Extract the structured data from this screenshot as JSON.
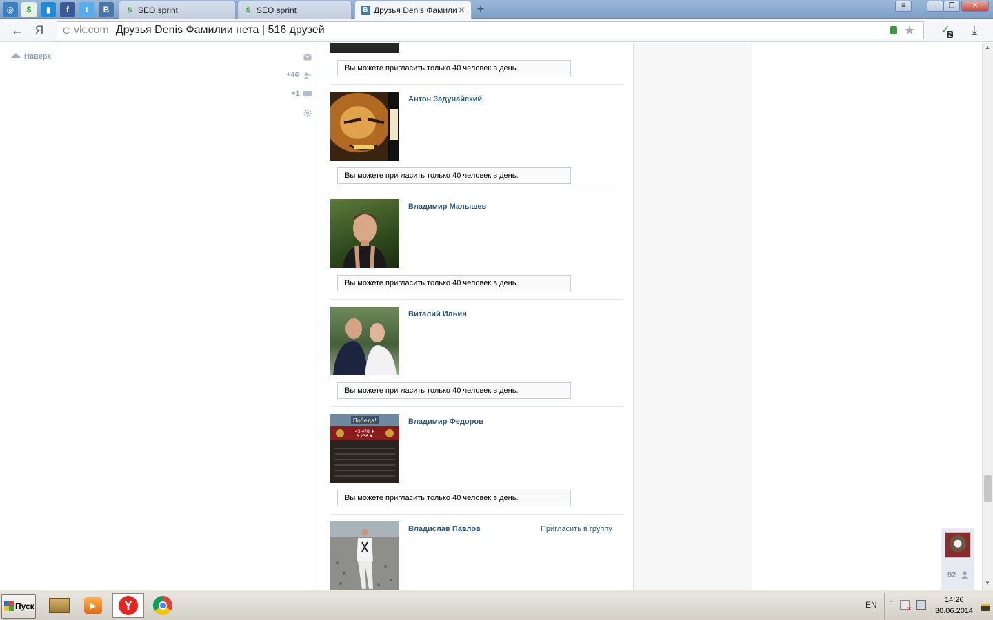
{
  "browser": {
    "tabs": [
      {
        "label": "SEO sprint",
        "active": false
      },
      {
        "label": "SEO sprint",
        "active": false
      },
      {
        "label": "Друзья Denis Фамилии н",
        "active": true
      }
    ],
    "new_tab": "+",
    "window_buttons": {
      "menu": "≡",
      "minimize": "–",
      "restore": "❐",
      "close": "✕"
    },
    "back": "←",
    "yandex_button": "Я",
    "reload": "C",
    "url_domain": "vk.com",
    "url_title": "Друзья Denis Фамилии нета | 516 друзей",
    "bookmark": "★",
    "protect_badge": "2",
    "download": "⤓"
  },
  "sidebar": {
    "up_label": "Наверх",
    "people_count": "+46",
    "comments_count": "+1"
  },
  "friends": [
    {
      "name": "",
      "notice": "Вы можете пригласить только 40 человек в день.",
      "invite": ""
    },
    {
      "name": "Антон Задунайский",
      "notice": "Вы можете пригласить только 40 человек в день.",
      "invite": ""
    },
    {
      "name": "Владимир Малышев",
      "notice": "Вы можете пригласить только 40 человек в день.",
      "invite": ""
    },
    {
      "name": "Виталий Ильин",
      "notice": "Вы можете пригласить только 40 человек в день.",
      "invite": ""
    },
    {
      "name": "Владимир Федоров",
      "notice": "Вы можете пригласить только 40 человек в день.",
      "invite": ""
    },
    {
      "name": "Владислав Павлов",
      "notice": "",
      "invite": "Пригласить в группу"
    }
  ],
  "game_screenshot": {
    "banner": "Победа!",
    "line1": "43 478 ♦",
    "line2": "3 236 ♦"
  },
  "chat_widget": {
    "online_count": "92"
  },
  "taskbar": {
    "start_label": "Пуск",
    "language": "EN",
    "time": "14:26",
    "date": "30.06.2014"
  },
  "colors": {
    "vk_link": "#2b587a",
    "tabbar": "#7e9fc7",
    "notice_border": "#c5cfd9"
  }
}
